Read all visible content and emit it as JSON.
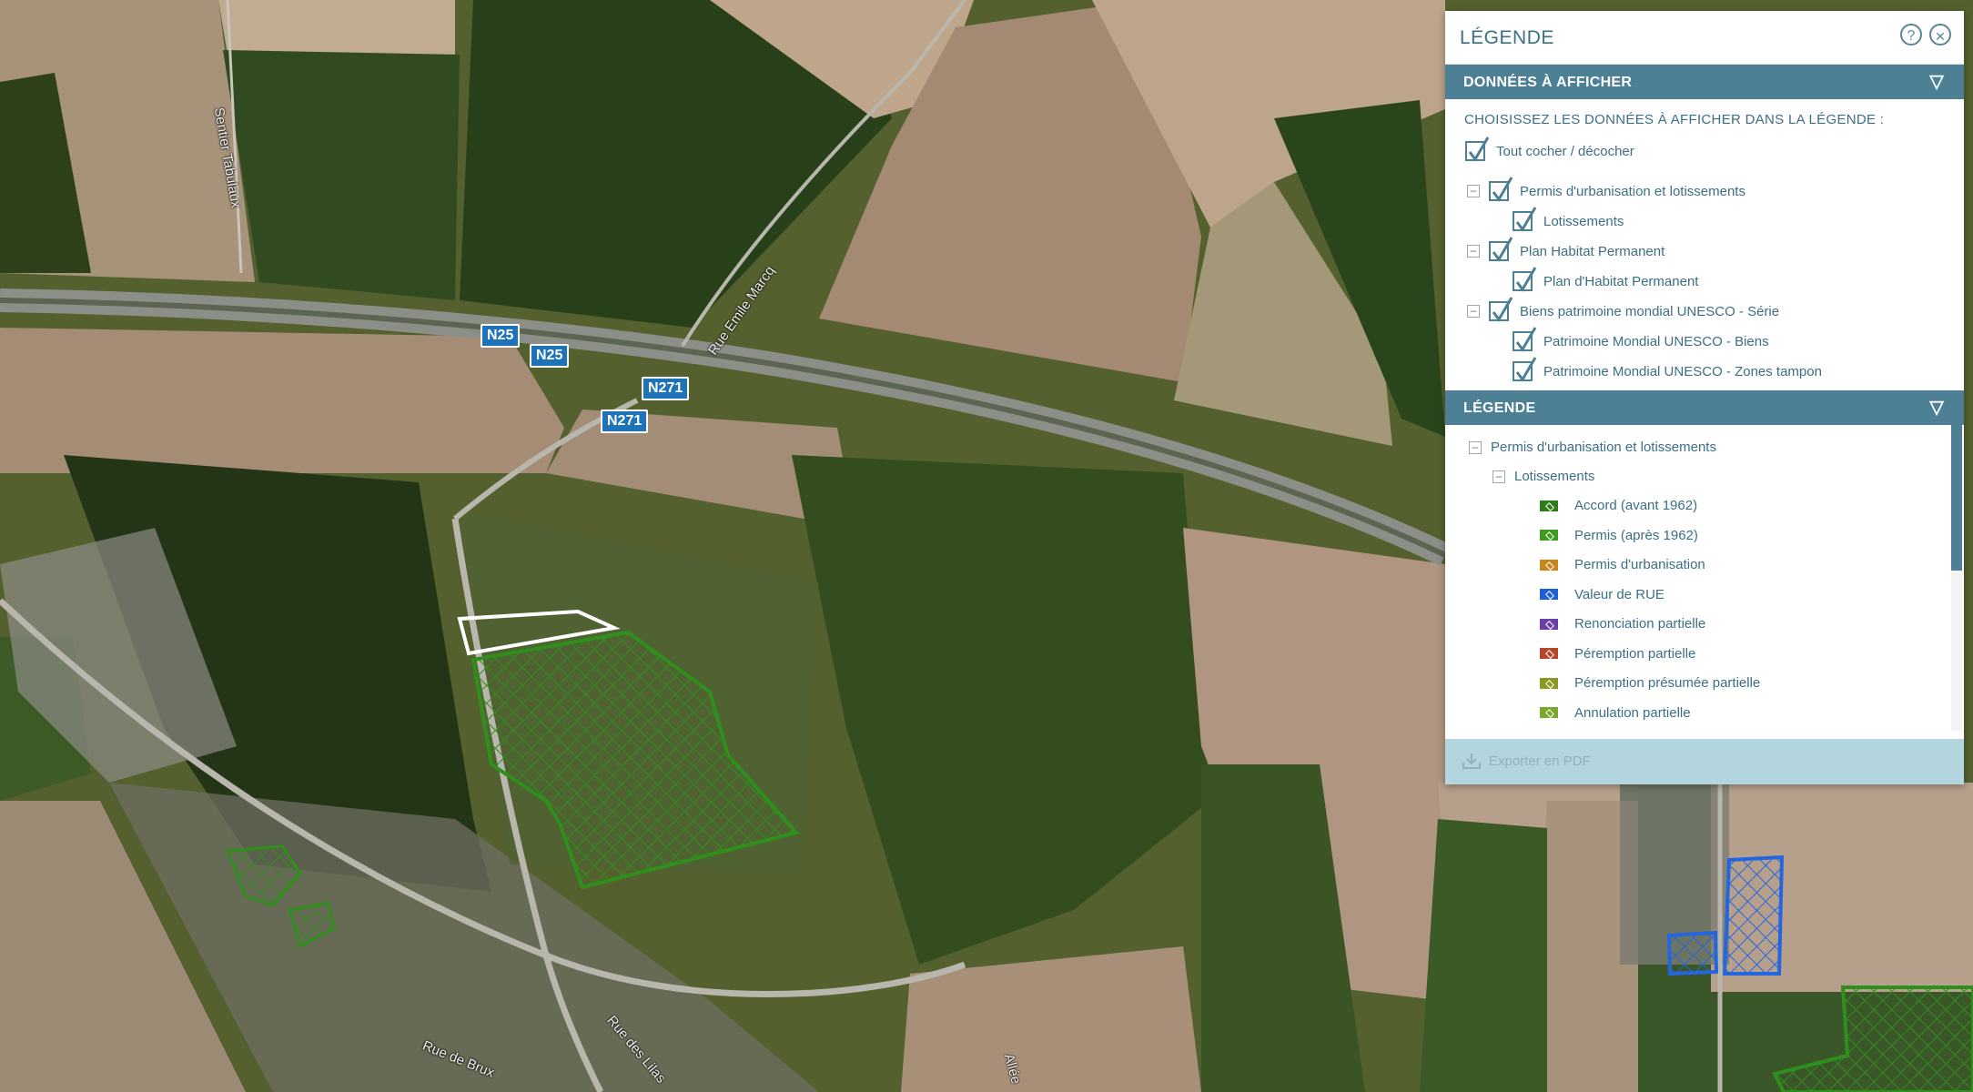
{
  "map": {
    "shields": [
      "N25",
      "N25",
      "N271",
      "N271"
    ],
    "streets": [
      "Sentier Tabulaux",
      "Rue Emile Marcq",
      "Rue de Brux",
      "Rue des Lilas",
      "Allée"
    ]
  },
  "panel": {
    "title": "LÉGENDE",
    "help_glyph": "?",
    "close_glyph": "✕",
    "data_section": {
      "header": "DONNÉES À AFFICHER",
      "instruction": "CHOISISSEZ LES DONNÉES À AFFICHER DANS LA LÉGENDE :",
      "toggle_all": "Tout cocher / décocher",
      "groups": [
        {
          "label": "Permis d'urbanisation et lotissements",
          "children": [
            "Lotissements"
          ]
        },
        {
          "label": "Plan Habitat Permanent",
          "children": [
            "Plan d'Habitat Permanent"
          ]
        },
        {
          "label": "Biens patrimoine mondial UNESCO - Série",
          "children": [
            "Patrimoine Mondial UNESCO - Biens",
            "Patrimoine Mondial UNESCO - Zones tampon"
          ]
        }
      ]
    },
    "legend_section": {
      "header": "LÉGENDE",
      "group": "Permis d'urbanisation et lotissements",
      "subgroup": "Lotissements",
      "items": [
        {
          "label": "Accord (avant 1962)",
          "color": "#2e7d1a"
        },
        {
          "label": "Permis (après 1962)",
          "color": "#3f9a22"
        },
        {
          "label": "Permis d'urbanisation",
          "color": "#c9861a"
        },
        {
          "label": "Valeur de RUE",
          "color": "#1d5fd6"
        },
        {
          "label": "Renonciation partielle",
          "color": "#6a3fa8"
        },
        {
          "label": "Péremption partielle",
          "color": "#b8452a"
        },
        {
          "label": "Péremption présumée partielle",
          "color": "#8a9a20"
        },
        {
          "label": "Annulation partielle",
          "color": "#7aa82a"
        }
      ]
    },
    "export_label": "Exporter en PDF"
  }
}
